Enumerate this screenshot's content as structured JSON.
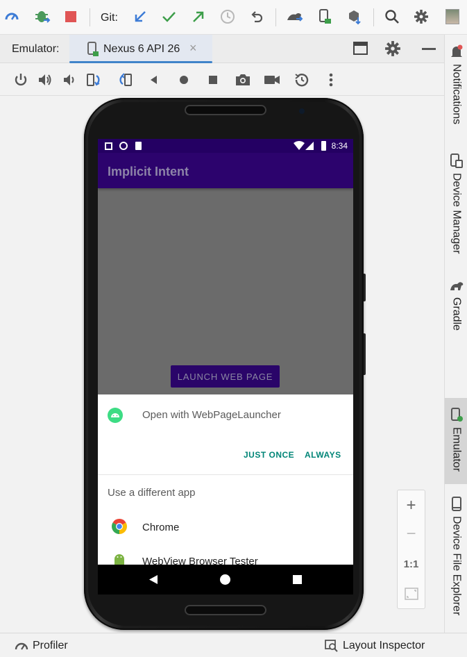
{
  "toolbar": {
    "git_label": "Git:",
    "icons": [
      "speedometer-icon",
      "debug-attach-icon",
      "stop-icon",
      "git-update-icon",
      "git-commit-icon",
      "git-push-icon",
      "history-icon",
      "rollback-icon",
      "device-sync-icon",
      "device-run-icon",
      "sdk-manager-icon",
      "search-icon",
      "settings-icon",
      "user-avatar"
    ]
  },
  "emulator_header": {
    "label": "Emulator:",
    "tab_title": "Nexus 6 API 26",
    "tab_close": "×"
  },
  "controls": [
    "power",
    "volume-up",
    "volume-down",
    "rotate-left",
    "rotate-right",
    "back",
    "home",
    "overview",
    "screenshot",
    "screen-record",
    "snapshot",
    "more"
  ],
  "phone": {
    "status_time": "8:34",
    "app_title": "Implicit Intent",
    "launch_button": "LAUNCH WEB PAGE",
    "chooser": {
      "open_with": "Open with WebPageLauncher",
      "just_once": "JUST ONCE",
      "always": "ALWAYS",
      "use_different": "Use a different app",
      "apps": [
        "Chrome",
        "WebView Browser Tester"
      ]
    }
  },
  "zoom": {
    "zoom_in": "+",
    "zoom_out": "−",
    "actual_size": "1:1"
  },
  "right_sidebar": {
    "items": [
      "Notifications",
      "Device Manager",
      "Gradle",
      "Emulator",
      "Device File Explorer"
    ],
    "active": "Emulator"
  },
  "bottom_bar": {
    "profiler": "Profiler",
    "layout_inspector": "Layout Inspector"
  },
  "colors": {
    "app_bar": "#2c036d",
    "accent_teal": "#008577",
    "tab_underline": "#4083c9",
    "stop_red": "#e05555",
    "green": "#3d9e4a",
    "blue": "#3d7cd6"
  }
}
